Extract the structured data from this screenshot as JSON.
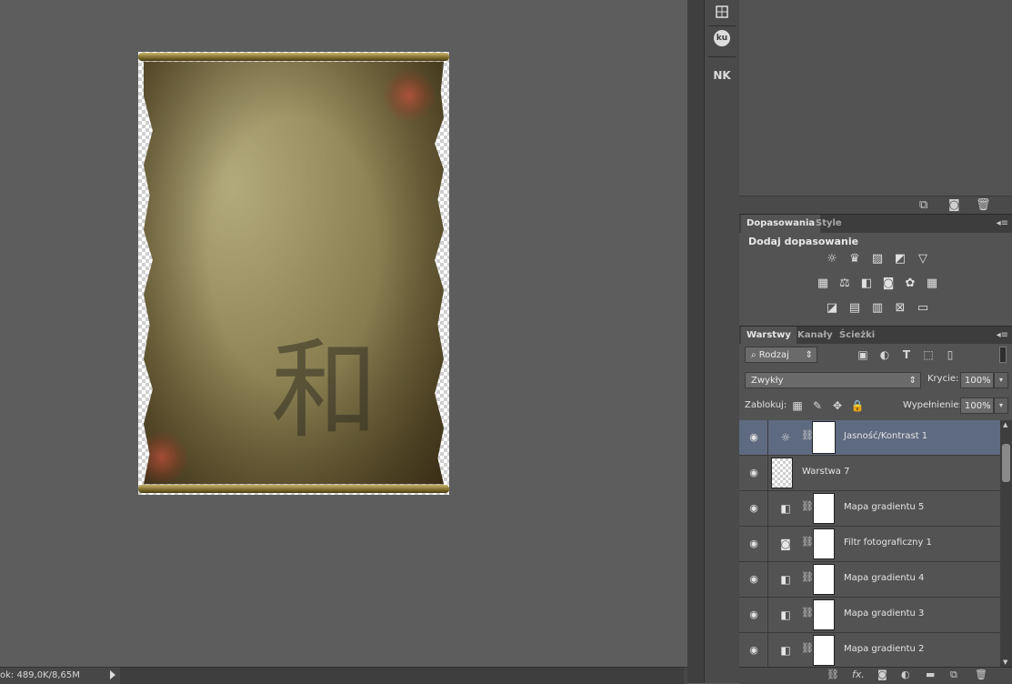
{
  "canvas": {
    "kanji": "和"
  },
  "status": {
    "doc_info": "ok: 489,0K/8,65M"
  },
  "icon_column": {
    "button_2": "ku",
    "button_3": "NK"
  },
  "adjustments_panel": {
    "tabs": [
      "Dopasowania",
      "Style"
    ],
    "heading": "Dodaj dopasowanie",
    "icon_rows": [
      [
        "brightness-contrast-icon",
        "levels-icon",
        "curves-icon",
        "exposure-icon",
        "gradient-triangle-icon"
      ],
      [
        "vibrance-icon",
        "color-balance-icon",
        "black-white-icon",
        "photo-filter-icon",
        "channel-mixer-icon",
        "color-lookup-icon"
      ],
      [
        "invert-icon",
        "posterize-icon",
        "threshold-icon",
        "selective-color-icon",
        "gradient-map-icon"
      ]
    ]
  },
  "layers_panel": {
    "tabs": [
      "Warstwy",
      "Kanały",
      "Ścieżki"
    ],
    "filter_kind": "Rodzaj",
    "blend_mode": "Zwykły",
    "opacity_label": "Krycie:",
    "opacity_value": "100%",
    "lock_label": "Zablokuj:",
    "fill_label": "Wypełnienie:",
    "fill_value": "100%",
    "layers": [
      {
        "name": "Jasność/Kontrast 1",
        "type": "adjustment",
        "icon": "☼",
        "selected": true
      },
      {
        "name": "Warstwa 7",
        "type": "pixel",
        "selected": false
      },
      {
        "name": "Mapa gradientu 5",
        "type": "adjustment",
        "icon": "◧",
        "selected": false
      },
      {
        "name": "Filtr fotograficzny 1",
        "type": "adjustment",
        "icon": "◙",
        "selected": false
      },
      {
        "name": "Mapa gradientu 4",
        "type": "adjustment",
        "icon": "◧",
        "selected": false
      },
      {
        "name": "Mapa gradientu 3",
        "type": "adjustment",
        "icon": "◧",
        "selected": false
      },
      {
        "name": "Mapa gradientu 2",
        "type": "adjustment",
        "icon": "◧",
        "selected": false
      }
    ]
  }
}
